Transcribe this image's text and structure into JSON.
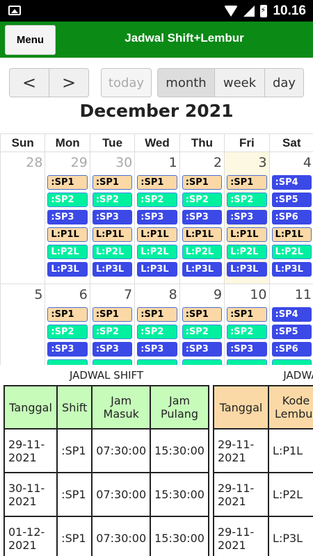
{
  "status_bar": {
    "time": "10.16",
    "icons": [
      "image-icon",
      "wifi-icon",
      "signal-icon",
      "battery-charging-icon"
    ]
  },
  "app_bar": {
    "menu_label": "Menu",
    "title": "Jadwal Shift+Lembur"
  },
  "toolbar": {
    "prev": "<",
    "next": ">",
    "today": "today",
    "month": "month",
    "week": "week",
    "day": "day"
  },
  "calendar": {
    "title": "December 2021",
    "weekdays": [
      "Sun",
      "Mon",
      "Tue",
      "Wed",
      "Thu",
      "Fri",
      "Sat"
    ],
    "weeks": [
      {
        "days": [
          {
            "num": "28",
            "other": true,
            "events": []
          },
          {
            "num": "29",
            "other": true,
            "events": [
              ":SP1",
              ":SP2",
              ":SP3",
              "L:P1L",
              "L:P2L",
              "L:P3L"
            ]
          },
          {
            "num": "30",
            "other": true,
            "events": [
              ":SP1",
              ":SP2",
              ":SP3",
              "L:P1L",
              "L:P2L",
              "L:P3L"
            ]
          },
          {
            "num": "1",
            "other": false,
            "events": [
              ":SP1",
              ":SP2",
              ":SP3",
              "L:P1L",
              "L:P2L",
              "L:P3L"
            ]
          },
          {
            "num": "2",
            "other": false,
            "events": [
              ":SP1",
              ":SP2",
              ":SP3",
              "L:P1L",
              "L:P2L",
              "L:P3L"
            ]
          },
          {
            "num": "3",
            "other": false,
            "today": true,
            "events": [
              ":SP1",
              ":SP2",
              ":SP3",
              "L:P1L",
              "L:P2L",
              "L:P3L"
            ]
          },
          {
            "num": "4",
            "other": false,
            "events": [
              ":SP4",
              ":SP5",
              ":SP6",
              "L:P1L",
              "L:P2L",
              "L:P3L"
            ]
          }
        ]
      },
      {
        "days": [
          {
            "num": "5",
            "other": false,
            "events": []
          },
          {
            "num": "6",
            "other": false,
            "events": [
              ":SP1",
              ":SP2",
              ":SP3",
              ""
            ]
          },
          {
            "num": "7",
            "other": false,
            "events": [
              ":SP1",
              ":SP2",
              ":SP3",
              ""
            ]
          },
          {
            "num": "8",
            "other": false,
            "events": [
              ":SP1",
              ":SP2",
              ":SP3",
              ""
            ]
          },
          {
            "num": "9",
            "other": false,
            "events": [
              ":SP1",
              ":SP2",
              ":SP3",
              ""
            ]
          },
          {
            "num": "10",
            "other": false,
            "events": [
              ":SP1",
              ":SP2",
              ":SP3",
              ""
            ]
          },
          {
            "num": "11",
            "other": false,
            "events": [
              ":SP4",
              ":SP5",
              ":SP6",
              ""
            ]
          }
        ]
      }
    ],
    "event_colors": {
      "c1": "#fbd9a6",
      "c2": "#00f0a0",
      "c3": "#3b49e6"
    }
  },
  "shift_table": {
    "caption": "JADWAL SHIFT",
    "headers": [
      "Tanggal",
      "Shift",
      "Jam Masuk",
      "Jam Pulang"
    ],
    "rows": [
      [
        "29-11-2021",
        ":SP1",
        "07:30:00",
        "15:30:00"
      ],
      [
        "30-11-2021",
        ":SP1",
        "07:30:00",
        "15:30:00"
      ],
      [
        "01-12-2021",
        ":SP1",
        "07:30:00",
        "15:30:00"
      ]
    ]
  },
  "lembur_table": {
    "caption": "JADWAL",
    "headers": [
      "Tanggal",
      "Kode Lembur"
    ],
    "rows": [
      [
        "29-11-2021",
        "L:P1L"
      ],
      [
        "29-11-2021",
        "L:P2L"
      ],
      [
        "29-11-2021",
        "L:P3L"
      ]
    ]
  }
}
